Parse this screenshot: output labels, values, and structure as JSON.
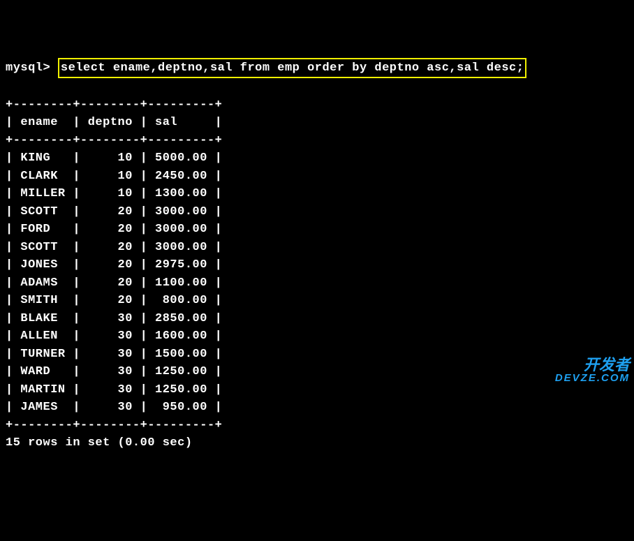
{
  "prompt": "mysql> ",
  "query": "select ename,deptno,sal from emp order by deptno asc,sal desc;",
  "separator_top": "+--------+--------+---------+",
  "header_line": "| ename  | deptno | sal     |",
  "separator_mid": "+--------+--------+---------+",
  "rows": [
    "| KING   |     10 | 5000.00 |",
    "| CLARK  |     10 | 2450.00 |",
    "| MILLER |     10 | 1300.00 |",
    "| SCOTT  |     20 | 3000.00 |",
    "| FORD   |     20 | 3000.00 |",
    "| SCOTT  |     20 | 3000.00 |",
    "| JONES  |     20 | 2975.00 |",
    "| ADAMS  |     20 | 1100.00 |",
    "| SMITH  |     20 |  800.00 |",
    "| BLAKE  |     30 | 2850.00 |",
    "| ALLEN  |     30 | 1600.00 |",
    "| TURNER |     30 | 1500.00 |",
    "| WARD   |     30 | 1250.00 |",
    "| MARTIN |     30 | 1250.00 |",
    "| JAMES  |     30 |  950.00 |"
  ],
  "separator_bot": "+--------+--------+---------+",
  "status": "15 rows in set (0.00 sec)",
  "watermark": {
    "line1": "开发者",
    "line2": "DEVZE.COM"
  },
  "chart_data": {
    "type": "table",
    "title": "select ename,deptno,sal from emp order by deptno asc,sal desc;",
    "columns": [
      "ename",
      "deptno",
      "sal"
    ],
    "data": [
      {
        "ename": "KING",
        "deptno": 10,
        "sal": 5000.0
      },
      {
        "ename": "CLARK",
        "deptno": 10,
        "sal": 2450.0
      },
      {
        "ename": "MILLER",
        "deptno": 10,
        "sal": 1300.0
      },
      {
        "ename": "SCOTT",
        "deptno": 20,
        "sal": 3000.0
      },
      {
        "ename": "FORD",
        "deptno": 20,
        "sal": 3000.0
      },
      {
        "ename": "SCOTT",
        "deptno": 20,
        "sal": 3000.0
      },
      {
        "ename": "JONES",
        "deptno": 20,
        "sal": 2975.0
      },
      {
        "ename": "ADAMS",
        "deptno": 20,
        "sal": 1100.0
      },
      {
        "ename": "SMITH",
        "deptno": 20,
        "sal": 800.0
      },
      {
        "ename": "BLAKE",
        "deptno": 30,
        "sal": 2850.0
      },
      {
        "ename": "ALLEN",
        "deptno": 30,
        "sal": 1600.0
      },
      {
        "ename": "TURNER",
        "deptno": 30,
        "sal": 1500.0
      },
      {
        "ename": "WARD",
        "deptno": 30,
        "sal": 1250.0
      },
      {
        "ename": "MARTIN",
        "deptno": 30,
        "sal": 1250.0
      },
      {
        "ename": "JAMES",
        "deptno": 30,
        "sal": 950.0
      }
    ],
    "row_count": 15
  }
}
